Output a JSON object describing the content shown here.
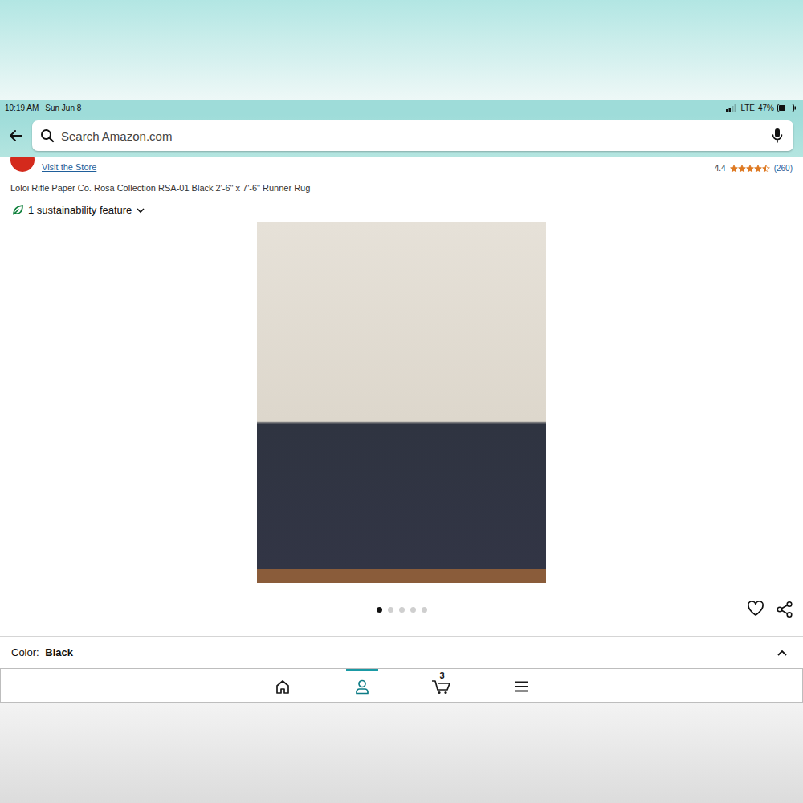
{
  "status_bar": {
    "time": "10:19 AM",
    "date": "Sun Jun 8",
    "signal": 0.5,
    "network": "LTE",
    "battery": "47%",
    "battery_level": 0.47
  },
  "search": {
    "placeholder": "Search Amazon.com"
  },
  "store": {
    "link": "Visit the Store"
  },
  "rating": {
    "value": "4.4",
    "stars": 4.5,
    "count": "(260)"
  },
  "product": {
    "title": "Loloi Rifle Paper Co. Rosa Collection RSA-01 Black 2'-6\" x 7'-6\" Runner Rug",
    "sustainability": "1 sustainability feature"
  },
  "carousel": {
    "dots": [
      {
        "selected": true
      },
      {
        "selected": false
      },
      {
        "selected": false
      },
      {
        "selected": false
      },
      {
        "selected": false
      }
    ]
  },
  "option": {
    "label": "Color:",
    "value": "Black",
    "expanded": true
  },
  "nav": {
    "items": [
      {
        "selected": false,
        "badge": ""
      },
      {
        "selected": true,
        "badge": ""
      },
      {
        "selected": false,
        "badge": "3"
      },
      {
        "selected": false,
        "badge": ""
      }
    ]
  }
}
